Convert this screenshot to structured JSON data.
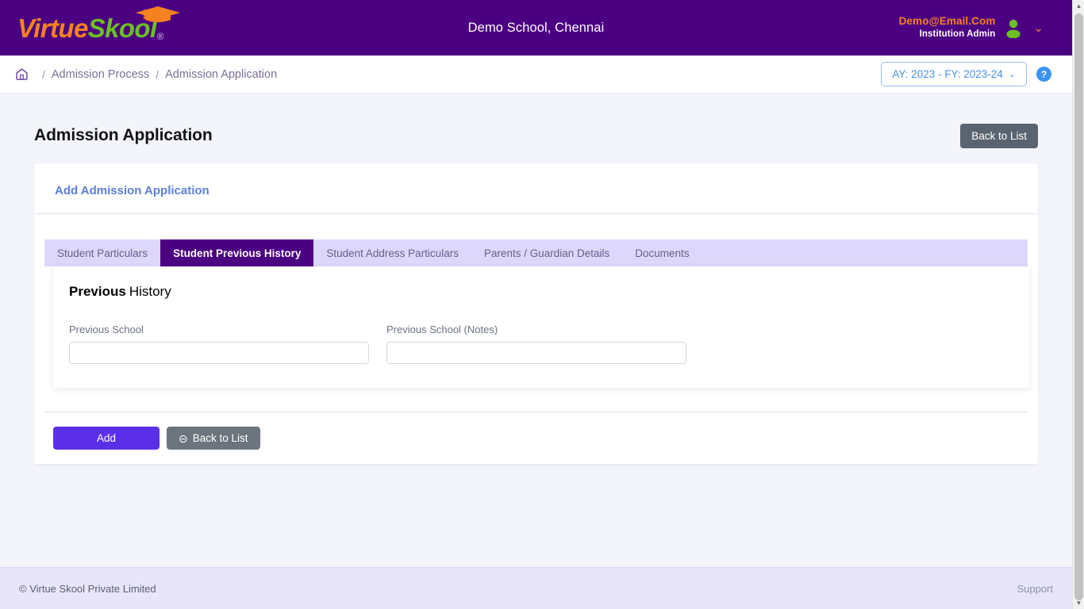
{
  "header": {
    "logo_virtue": "Virtue",
    "logo_skool": "Skool",
    "logo_reg": "®",
    "logo_cap_icon": "graduation-cap-icon",
    "school_title": "Demo School, Chennai",
    "user_email": "Demo@Email.Com",
    "user_role": "Institution Admin",
    "avatar_icon": "user-avatar-icon",
    "caret_icon": "chevron-down-icon"
  },
  "breadcrumb": {
    "home_icon": "home-icon",
    "separator": "/",
    "items": [
      {
        "label": "Admission Process"
      },
      {
        "label": "Admission Application"
      }
    ],
    "academic_year": "AY: 2023 - FY: 2023-24",
    "ay_caret_icon": "chevron-down-icon",
    "help_label": "?"
  },
  "page": {
    "title": "Admission Application",
    "back_to_list_top": "Back to List"
  },
  "card": {
    "header_title": "Add Admission Application"
  },
  "tabs": [
    {
      "label": "Student Particulars",
      "active": false
    },
    {
      "label": "Student Previous History",
      "active": true
    },
    {
      "label": "Student Address Particulars",
      "active": false
    },
    {
      "label": "Parents / Guardian Details",
      "active": false
    },
    {
      "label": "Documents",
      "active": false
    }
  ],
  "section": {
    "title_bold": "Previous",
    "title_rest": "History",
    "fields": [
      {
        "label": "Previous School",
        "value": "",
        "placeholder": ""
      },
      {
        "label": "Previous School (Notes)",
        "value": "",
        "placeholder": ""
      }
    ]
  },
  "actions": {
    "add_label": "Add",
    "back_label": "Back to List",
    "back_arrow_icon": "circle-arrow-left-icon"
  },
  "footer": {
    "copyright": "© Virtue Skool Private Limited",
    "support": "Support"
  },
  "colors": {
    "brand_purple": "#4b0082",
    "brand_orange": "#f5821f",
    "brand_green": "#6cc024",
    "accent_indigo": "#5b2fe8",
    "link_blue": "#5a7fd6",
    "tab_bar_lavender": "#ddd8fb"
  }
}
